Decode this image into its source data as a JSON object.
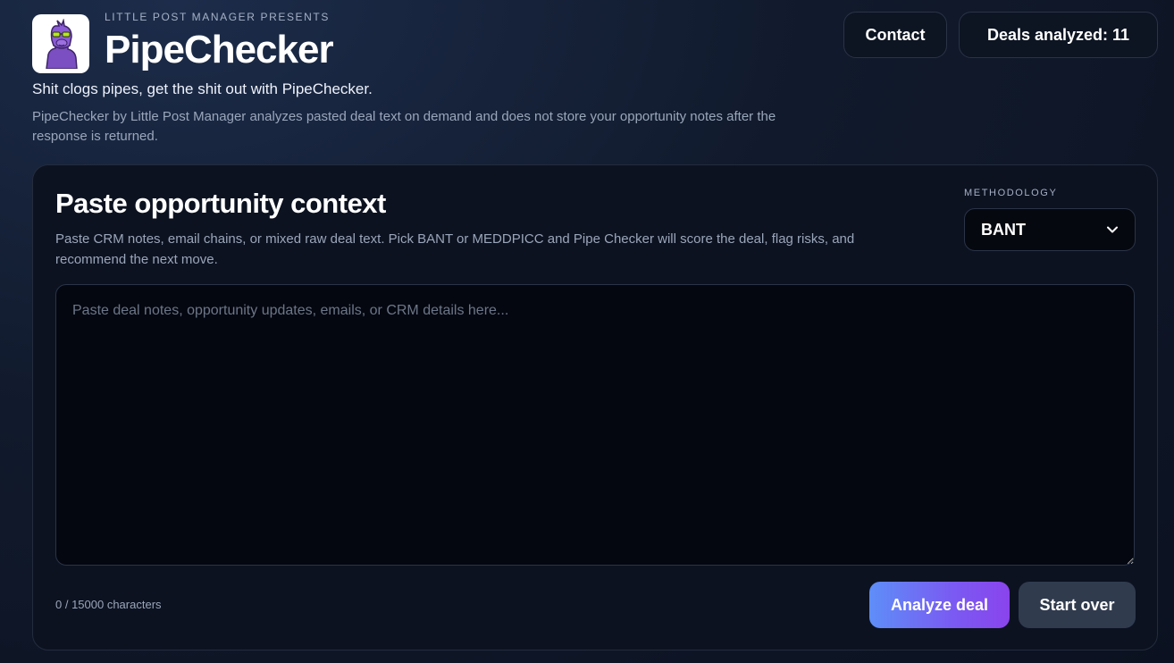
{
  "header": {
    "eyebrow": "LITTLE POST MANAGER PRESENTS",
    "title": "PipeChecker",
    "tagline": "Shit clogs pipes, get the shit out with PipeChecker.",
    "privacy_note": "PipeChecker by Little Post Manager analyzes pasted deal text on demand and does not store your opportunity notes after the response is returned.",
    "logo_icon": "llama-with-sunglasses-icon",
    "contact_label": "Contact",
    "deals_analyzed_label": "Deals analyzed: 11"
  },
  "card": {
    "title": "Paste opportunity context",
    "description": "Paste CRM notes, email chains, or mixed raw deal text. Pick BANT or MEDDPICC and Pipe Checker will score the deal, flag risks, and recommend the next move.",
    "methodology_label": "METHODOLOGY",
    "methodology_value": "BANT",
    "textarea_value": "",
    "textarea_placeholder": "Paste deal notes, opportunity updates, emails, or CRM details here...",
    "char_count": "0 / 15000 characters",
    "analyze_label": "Analyze deal",
    "reset_label": "Start over"
  },
  "colors": {
    "background": "#0b1120",
    "card": "#0c1220",
    "accent_start": "#5e8ef8",
    "accent_end": "#8a44ec",
    "secondary_button": "#303b4e",
    "logo_llama": "#7b4fc2",
    "logo_glasses": "#b6e820"
  }
}
